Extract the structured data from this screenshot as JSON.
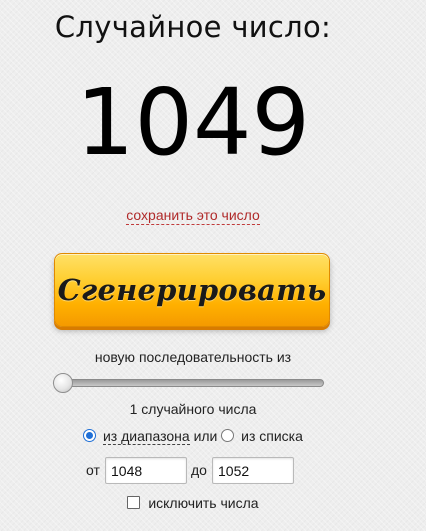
{
  "header": {
    "title": "Случайное число:"
  },
  "result": {
    "number": "1049",
    "save_link": "сохранить это число"
  },
  "generate": {
    "button_label": "Сгенерировать"
  },
  "sequence": {
    "label": "новую последовательность из",
    "slider_value": 1,
    "count_text": "1 случайного числа"
  },
  "source": {
    "option_range": "из диапазона",
    "connector": "или",
    "option_list": "из списка",
    "selected": "range"
  },
  "range": {
    "from_label": "от",
    "from_value": "1048",
    "to_label": "до",
    "to_value": "1052"
  },
  "exclude": {
    "label": "исключить числа",
    "checked": false
  },
  "colors": {
    "accent": "#1f6fd6",
    "link": "#b02a2a",
    "button": "#ffb000"
  }
}
